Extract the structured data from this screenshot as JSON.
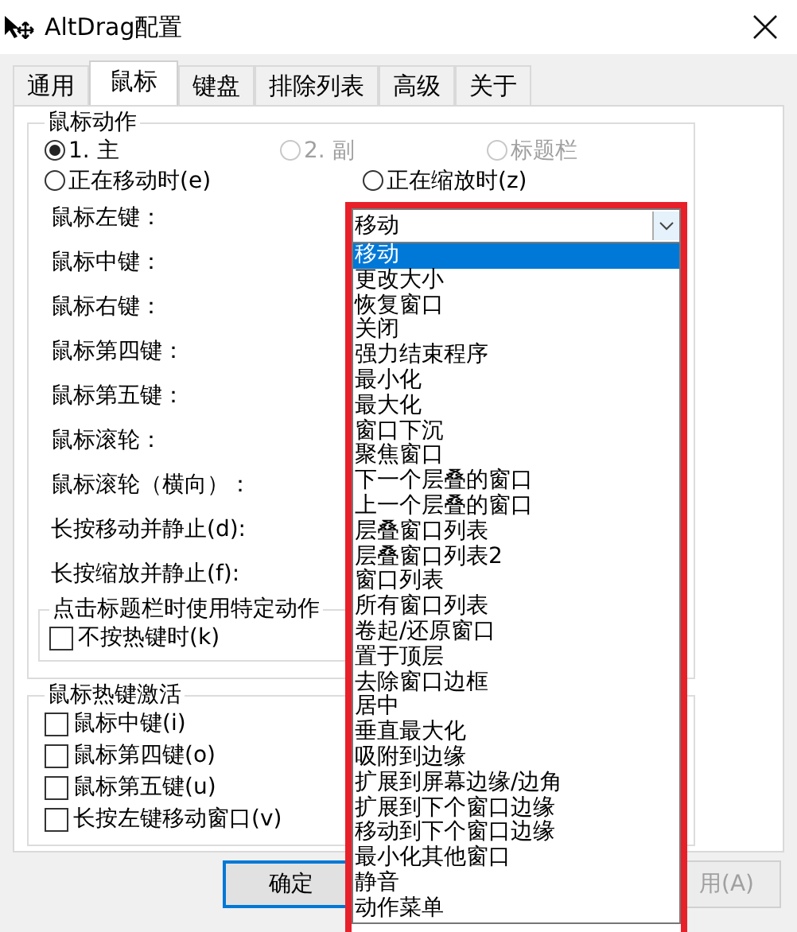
{
  "window": {
    "title": "AltDrag配置"
  },
  "tabs": [
    {
      "label": "通用",
      "selected": false
    },
    {
      "label": "鼠标",
      "selected": true
    },
    {
      "label": "键盘",
      "selected": false
    },
    {
      "label": "排除列表",
      "selected": false
    },
    {
      "label": "高级",
      "selected": false
    },
    {
      "label": "关于",
      "selected": false
    }
  ],
  "mouse_actions": {
    "title": "鼠标动作",
    "buttons": [
      {
        "label": "1. 主",
        "selected": true,
        "disabled": false
      },
      {
        "label": "2. 副",
        "selected": false,
        "disabled": true
      },
      {
        "label": "标题栏",
        "selected": false,
        "disabled": true
      }
    ],
    "states": [
      {
        "label": "正在移动时(e)",
        "selected": false
      },
      {
        "label": "正在缩放时(z)",
        "selected": false
      }
    ],
    "bindings": [
      {
        "label": "鼠标左键："
      },
      {
        "label": "鼠标中键："
      },
      {
        "label": "鼠标右键："
      },
      {
        "label": "鼠标第四键："
      },
      {
        "label": "鼠标第五键："
      },
      {
        "label": "鼠标滚轮："
      },
      {
        "label": "鼠标滚轮（横向）："
      },
      {
        "label": "长按移动并静止(d):"
      },
      {
        "label": "长按缩放并静止(f):"
      }
    ]
  },
  "title_click": {
    "title": "点击标题栏时使用特定动作",
    "checkbox": {
      "label": "不按热键时(k)",
      "checked": false
    }
  },
  "hotkeys": {
    "title": "鼠标热键激活",
    "items": [
      {
        "label": "鼠标中键(i)",
        "checked": false
      },
      {
        "label": "鼠标第四键(o)",
        "checked": false
      },
      {
        "label": "鼠标第五键(u)",
        "checked": false
      },
      {
        "label": "长按左键移动窗口(v)",
        "checked": false
      }
    ]
  },
  "buttons": [
    {
      "label": "确定",
      "default": true,
      "disabled": false
    },
    {
      "label": "用(A)",
      "default": false,
      "disabled": true
    }
  ],
  "dropdown": {
    "value": "移动",
    "options": [
      {
        "label": "移动",
        "selected": true
      },
      {
        "label": "更改大小",
        "selected": false
      },
      {
        "label": "恢复窗口",
        "selected": false
      },
      {
        "label": "关闭",
        "selected": false
      },
      {
        "label": "强力结束程序",
        "selected": false
      },
      {
        "label": "最小化",
        "selected": false
      },
      {
        "label": "最大化",
        "selected": false
      },
      {
        "label": "窗口下沉",
        "selected": false
      },
      {
        "label": "聚焦窗口",
        "selected": false
      },
      {
        "label": "下一个层叠的窗口",
        "selected": false
      },
      {
        "label": "上一个层叠的窗口",
        "selected": false
      },
      {
        "label": "层叠窗口列表",
        "selected": false
      },
      {
        "label": "层叠窗口列表2",
        "selected": false
      },
      {
        "label": "窗口列表",
        "selected": false
      },
      {
        "label": "所有窗口列表",
        "selected": false
      },
      {
        "label": "卷起/还原窗口",
        "selected": false
      },
      {
        "label": "置于顶层",
        "selected": false
      },
      {
        "label": "去除窗口边框",
        "selected": false
      },
      {
        "label": "居中",
        "selected": false
      },
      {
        "label": "垂直最大化",
        "selected": false
      },
      {
        "label": "吸附到边缘",
        "selected": false
      },
      {
        "label": "扩展到屏幕边缘/边角",
        "selected": false
      },
      {
        "label": "扩展到下个窗口边缘",
        "selected": false
      },
      {
        "label": "移动到下个窗口边缘",
        "selected": false
      },
      {
        "label": "最小化其他窗口",
        "selected": false
      },
      {
        "label": "静音",
        "selected": false
      },
      {
        "label": "动作菜单",
        "selected": false
      }
    ]
  }
}
